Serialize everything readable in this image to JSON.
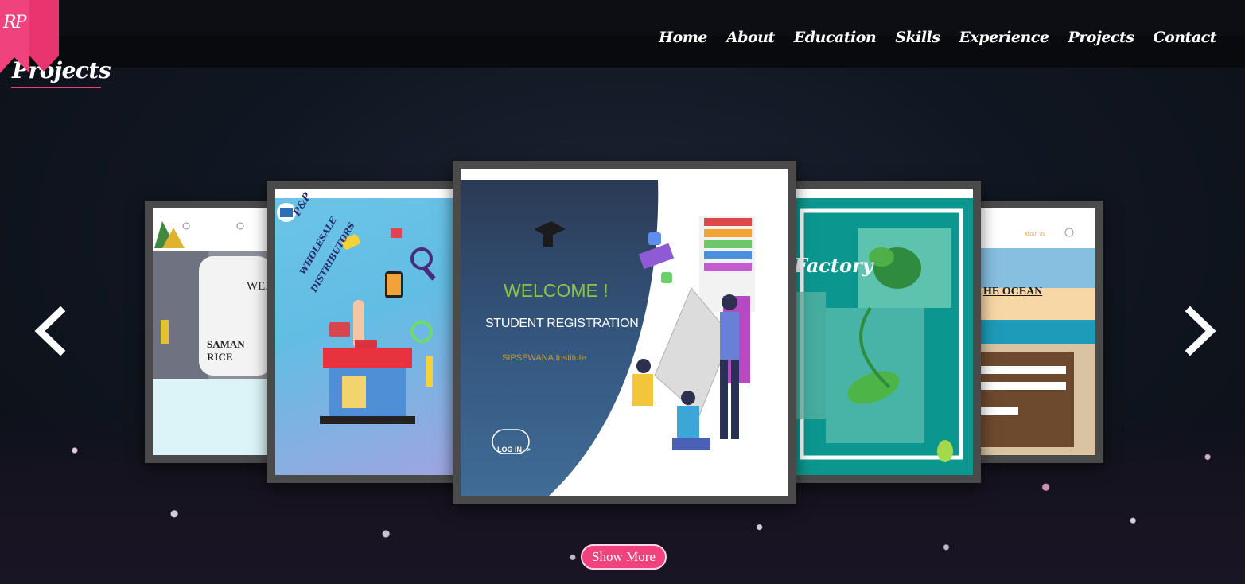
{
  "logo": {
    "text": "RP"
  },
  "nav": {
    "items": [
      {
        "label": "Home"
      },
      {
        "label": "About"
      },
      {
        "label": "Education"
      },
      {
        "label": "Skills"
      },
      {
        "label": "Experience"
      },
      {
        "label": "Projects"
      },
      {
        "label": "Contact"
      }
    ]
  },
  "section": {
    "title": "Projects"
  },
  "carousel": {
    "prev_icon": "chevron-left-icon",
    "next_icon": "chevron-right-icon",
    "cards": [
      {
        "name": "rice-mill",
        "lines": [
          "WEL",
          "SAMAN RICE"
        ]
      },
      {
        "name": "wholesale",
        "lines": [
          "P&P",
          "WHOLESALE",
          "DISTRIBUTORS"
        ]
      },
      {
        "name": "student-registration",
        "lines": [
          "WELCOME !",
          "STUDENT REGISTRATION",
          "SIPSEWANA Institute",
          "LOG IN ->"
        ]
      },
      {
        "name": "tea-factory",
        "lines": [
          "Factory"
        ]
      },
      {
        "name": "ocean-hotel",
        "lines": [
          "HE OCEAN",
          "ABOUT US"
        ]
      }
    ]
  },
  "show_more": {
    "label": "Show More"
  },
  "colors": {
    "accent": "#f0427c",
    "card_frame": "#4a4a4a"
  }
}
